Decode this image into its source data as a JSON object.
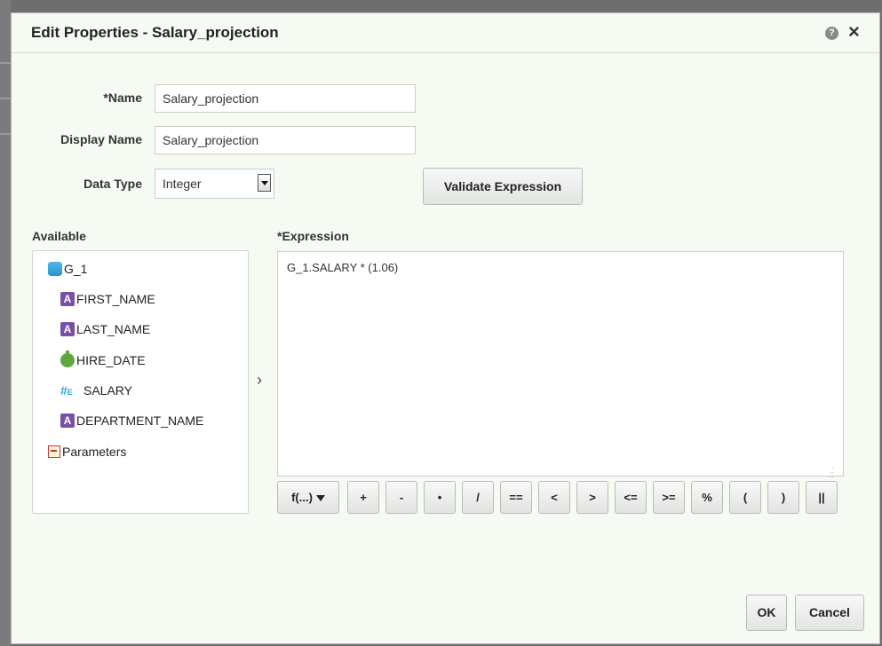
{
  "dialog": {
    "title": "Edit Properties - Salary_projection",
    "help_icon": "?",
    "close_icon": "×"
  },
  "form": {
    "name_label": "*Name",
    "name_value": "Salary_projection",
    "display_name_label": "Display Name",
    "display_name_value": "Salary_projection",
    "data_type_label": "Data Type",
    "data_type_value": "Integer",
    "validate_label": "Validate Expression"
  },
  "available": {
    "label": "Available",
    "root": "G_1",
    "fields": [
      {
        "name": "FIRST_NAME",
        "icon": "text-type-icon"
      },
      {
        "name": "LAST_NAME",
        "icon": "text-type-icon"
      },
      {
        "name": "HIRE_DATE",
        "icon": "date-type-icon"
      },
      {
        "name": "SALARY",
        "icon": "number-type-icon"
      },
      {
        "name": "DEPARTMENT_NAME",
        "icon": "text-type-icon"
      }
    ],
    "parameters": "Parameters",
    "icon_a": "A",
    "icon_num": "#",
    "icon_num_suffix": "E"
  },
  "move_arrow": "›",
  "expression": {
    "label": "*Expression",
    "value": "G_1.SALARY * (1.06)"
  },
  "operators": {
    "function": "f(...)",
    "items": [
      "+",
      "-",
      "•",
      "/",
      "==",
      "<",
      ">",
      "<=",
      ">=",
      "%",
      "(",
      ")",
      "||"
    ]
  },
  "footer": {
    "ok": "OK",
    "cancel": "Cancel"
  }
}
